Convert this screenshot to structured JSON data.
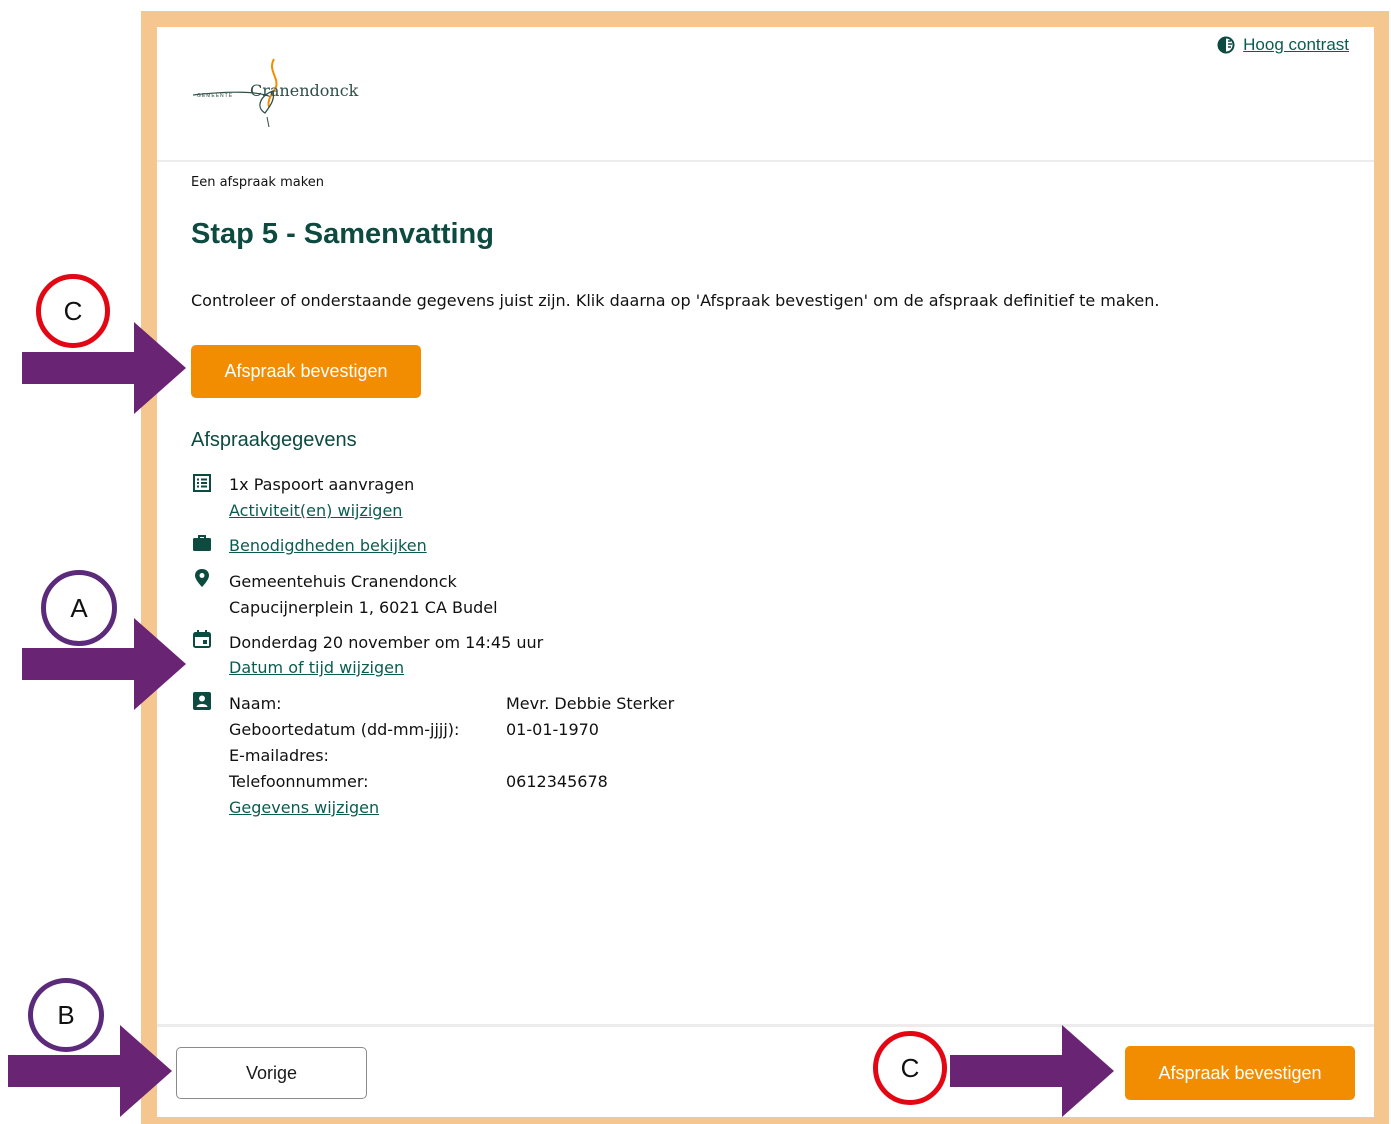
{
  "header": {
    "logo_name": "Cranendonck",
    "logo_subtext": "GEMEENTE",
    "contrast_link": "Hoog contrast"
  },
  "breadcrumb": "Een afspraak maken",
  "page_title": "Stap 5 - Samenvatting",
  "intro": "Controleer of onderstaande gegevens juist zijn. Klik daarna op 'Afspraak bevestigen' om de afspraak definitief te maken.",
  "confirm_label": "Afspraak bevestigen",
  "previous_label": "Vorige",
  "summary": {
    "heading": "Afspraakgegevens",
    "activity": "1x Paspoort aanvragen",
    "change_activity": "Activiteit(en) wijzigen",
    "requirements_link": "Benodigdheden bekijken",
    "location_name": "Gemeentehuis Cranendonck",
    "location_address": "Capucijnerplein 1, 6021 CA Budel",
    "datetime": "Donderdag 20 november om 14:45 uur",
    "change_datetime": "Datum of tijd wijzigen",
    "fields": [
      {
        "label": "Naam:",
        "value": "Mevr. Debbie Sterker"
      },
      {
        "label": "Geboortedatum (dd-mm-jjjj):",
        "value": "01-01-1970"
      },
      {
        "label": "E-mailadres:",
        "value": ""
      },
      {
        "label": "Telefoonnummer:",
        "value": "0612345678"
      }
    ],
    "change_details": "Gegevens wijzigen"
  },
  "annotations": {
    "a": "A",
    "b": "B",
    "c": "C"
  },
  "colors": {
    "accent_orange": "#f28c00",
    "frame_peach": "#f5c68f",
    "heading_green": "#0d4a40",
    "link_green": "#0b5c50",
    "arrow_purple": "#6a2474",
    "marker_red": "#e30613",
    "marker_purple": "#5b2a7a"
  }
}
